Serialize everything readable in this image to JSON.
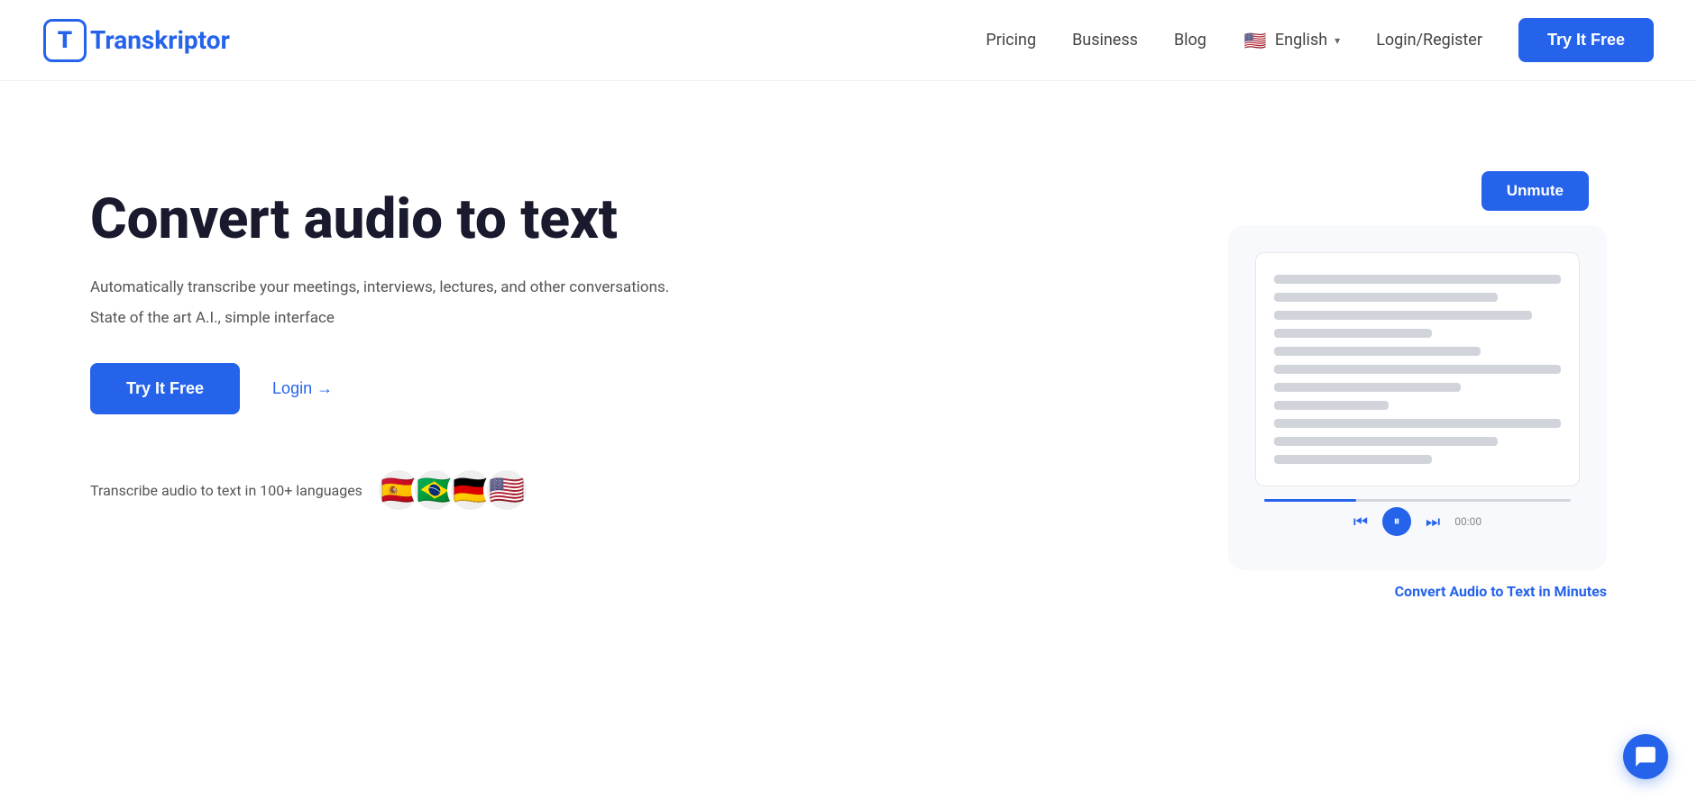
{
  "brand": {
    "logo_letter": "T",
    "name_prefix": "ranskriptor"
  },
  "nav": {
    "pricing": "Pricing",
    "business": "Business",
    "blog": "Blog",
    "language": "English",
    "login_register": "Login/Register",
    "try_free": "Try It Free"
  },
  "hero": {
    "title": "Convert audio to text",
    "desc": "Automatically transcribe your meetings, interviews, lectures, and other conversations.",
    "sub": "State of the art A.I., simple interface",
    "btn_try": "Try It Free",
    "btn_login": "Login →",
    "lang_text": "Transcribe audio to text in 100+ languages",
    "flags": [
      "🇪🇸",
      "🇧🇷",
      "🇩🇪",
      "🇺🇸"
    ]
  },
  "preview_card": {
    "unmute": "Unmute",
    "caption": "Convert Audio to Text in Minutes",
    "audio_time": "00:00"
  },
  "icons": {
    "chevron_down": "▾",
    "arrow_right": "→",
    "skip_back": "⏮",
    "pause": "⏸",
    "skip_fwd": "⏭",
    "chat": "💬"
  }
}
